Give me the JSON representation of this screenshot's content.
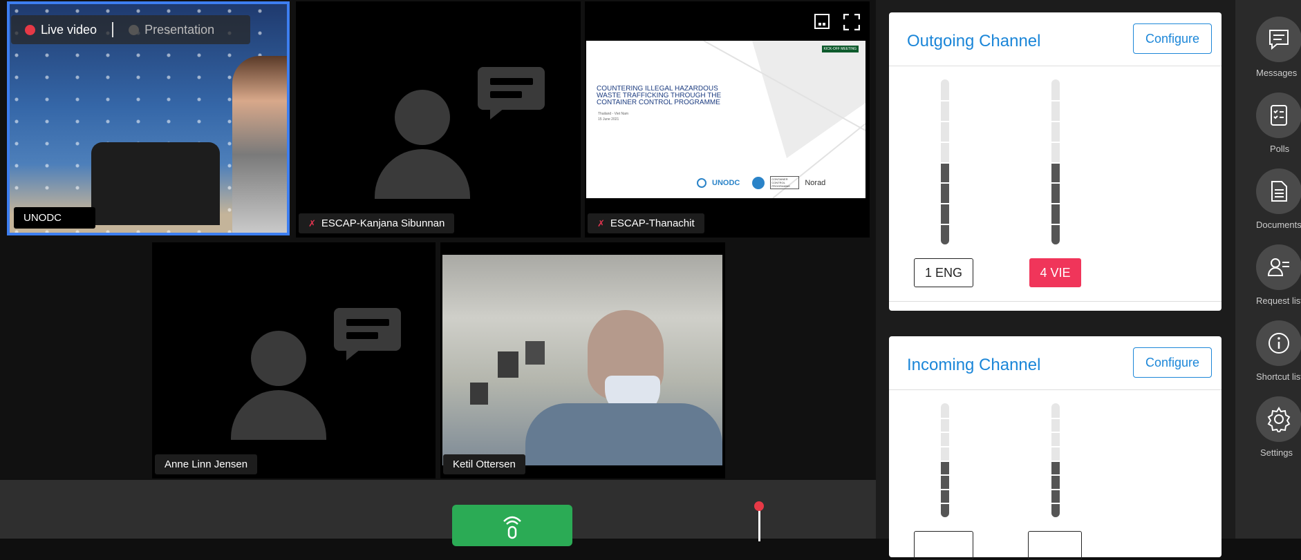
{
  "toggle": {
    "live_label": "Live video",
    "presentation_label": "Presentation"
  },
  "participants": [
    {
      "name": "UNODC"
    },
    {
      "name": "ESCAP-Kanjana Sibunnan"
    },
    {
      "name": "ESCAP-Thanachit"
    },
    {
      "name": "Anne Linn Jensen"
    },
    {
      "name": "Ketil Ottersen"
    }
  ],
  "slide": {
    "badge": "KICK-OFF MEETING",
    "title": "COUNTERING ILLEGAL HAZARDOUS WASTE TRAFFICKING THROUGH THE CONTAINER CONTROL PROGRAMME",
    "subtitle": "Thailand - Viet Nam",
    "date": "15 June 2021",
    "logo_unodc": "UNODC",
    "logo_ccp": "CONTAINER CONTROL PROGRAMME",
    "logo_norad": "Norad"
  },
  "outgoing": {
    "title": "Outgoing Channel",
    "configure_label": "Configure",
    "channels": [
      {
        "label": "1 ENG",
        "level": 0.5,
        "active": false
      },
      {
        "label": "4 VIE",
        "level": 0.5,
        "active": true
      }
    ]
  },
  "incoming": {
    "title": "Incoming Channel",
    "configure_label": "Configure",
    "channels": [
      {
        "level": 0.5
      },
      {
        "level": 0.5
      }
    ]
  },
  "sidebar": {
    "items": [
      {
        "label": "Messages",
        "icon": "messages-icon"
      },
      {
        "label": "Polls",
        "icon": "polls-icon"
      },
      {
        "label": "Documents",
        "icon": "documents-icon"
      },
      {
        "label": "Request list",
        "icon": "request-list-icon"
      },
      {
        "label": "Shortcut list",
        "icon": "info-icon"
      },
      {
        "label": "Settings",
        "icon": "gear-icon"
      }
    ]
  },
  "colors": {
    "accent": "#1b86d8",
    "active_channel": "#f0355a",
    "mic_button": "#2bab55",
    "highlight_border": "#3d7ef0"
  }
}
